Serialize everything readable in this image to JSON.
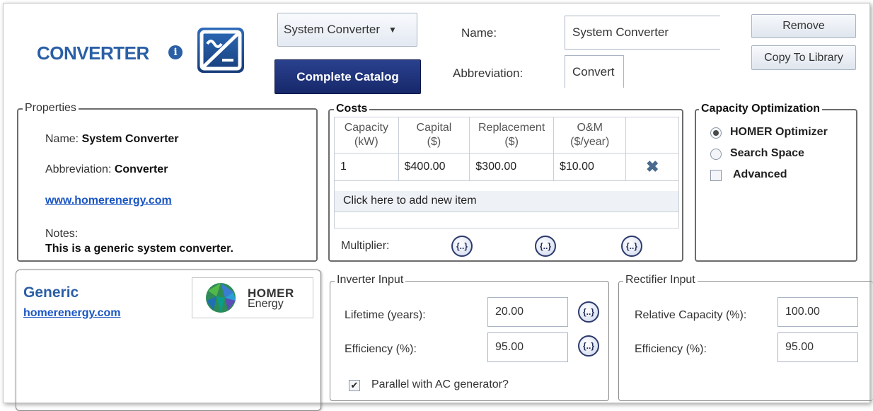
{
  "header": {
    "title": "CONVERTER",
    "info_icon": "info-icon",
    "dropdown_value": "System Converter",
    "catalog_button": "Complete Catalog",
    "name_label": "Name:",
    "name_value": "System Converter",
    "abbreviation_label": "Abbreviation:",
    "abbreviation_value": "Convert",
    "remove_button": "Remove",
    "copy_button": "Copy To Library"
  },
  "properties": {
    "legend": "Properties",
    "name_label": "Name:",
    "name_value": "System Converter",
    "abbreviation_label": "Abbreviation:",
    "abbreviation_value": "Converter",
    "link": "www.homerenergy.com",
    "notes_label": "Notes:",
    "notes_value": "This is a generic system converter."
  },
  "costs": {
    "legend": "Costs",
    "columns": [
      {
        "line1": "Capacity",
        "line2": "(kW)"
      },
      {
        "line1": "Capital",
        "line2": "($)"
      },
      {
        "line1": "Replacement",
        "line2": "($)"
      },
      {
        "line1": "O&M",
        "line2": "($/year)"
      }
    ],
    "rows": [
      {
        "capacity": "1",
        "capital": "$400.00",
        "replacement": "$300.00",
        "om": "$10.00"
      }
    ],
    "add_item": "Click here to add new item",
    "multiplier_label": "Multiplier:",
    "fx_text": "{..}"
  },
  "capacity_optimization": {
    "legend": "Capacity Optimization",
    "option_1": "HOMER Optimizer",
    "option_2": "Search Space",
    "advanced": "Advanced",
    "selected": "HOMER Optimizer"
  },
  "manufacturer": {
    "name": "Generic",
    "link": "homerenergy.com",
    "logo_line1": "HOMER",
    "logo_line2": "Energy"
  },
  "inverter": {
    "legend": "Inverter Input",
    "lifetime_label": "Lifetime (years):",
    "lifetime_value": "20.00",
    "efficiency_label": "Efficiency (%):",
    "efficiency_value": "95.00",
    "parallel_label": "Parallel with AC generator?",
    "parallel_checked": true
  },
  "rectifier": {
    "legend": "Rectifier Input",
    "capacity_label": "Relative Capacity (%):",
    "capacity_value": "100.00",
    "efficiency_label": "Efficiency (%):",
    "efficiency_value": "95.00"
  },
  "colors": {
    "brand_blue": "#2b5fa6",
    "catalog_button": "#1c2f7a",
    "link": "#1a55c2"
  }
}
